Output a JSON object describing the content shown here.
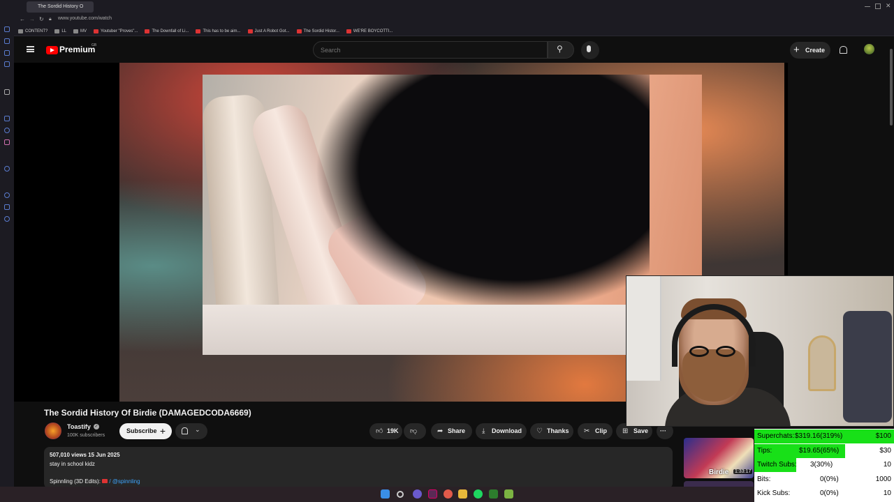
{
  "browser": {
    "tab_title": "The Sordid History O",
    "url": "www.youtube.com/watch",
    "bookmarks": [
      {
        "label": "CONTENT?"
      },
      {
        "label": "LL"
      },
      {
        "label": "MV"
      },
      {
        "label": "Youtuber \"Proves\"..."
      },
      {
        "label": "The Downfall of Li..."
      },
      {
        "label": "This has to be aim..."
      },
      {
        "label": "Just A Robot Got..."
      },
      {
        "label": "The Sordid Histor..."
      },
      {
        "label": "WE'RE BOYCOTTI..."
      }
    ]
  },
  "yt_header": {
    "logo_text": "Premium",
    "region": "GB",
    "search_placeholder": "Search",
    "create_label": "Create"
  },
  "video": {
    "title": "The Sordid History Of Birdie (DAMAGEDCODA6669)",
    "channel": "Toastify",
    "subscribers": "100K subscribers",
    "subscribe_label": "Subscribe",
    "likes": "19K",
    "share_label": "Share",
    "download_label": "Download",
    "thanks_label": "Thanks",
    "clip_label": "Clip",
    "save_label": "Save",
    "more_label": "···"
  },
  "description": {
    "views_date": "507,010 views  15 Jun 2025",
    "text": "stay in school kidz",
    "credit_prefix": "Spinnling (3D Edits): ",
    "credit_link": "/ @spinnling"
  },
  "related": {
    "thumb_text": "Birdie",
    "duration": "1:33:17"
  },
  "stats": [
    {
      "label": "Superchats:",
      "value": "$319.16(319%)",
      "goal": "$100",
      "fill": 1.0
    },
    {
      "label": "Tips:",
      "value": "$19.65(65%)",
      "goal": "$30",
      "fill": 0.65
    },
    {
      "label": "Twitch Subs:",
      "value": "3(30%)",
      "goal": "10",
      "fill": 0.3
    },
    {
      "label": "Bits:",
      "value": "0(0%)",
      "goal": "1000",
      "fill": 0
    },
    {
      "label": "Kick Subs:",
      "value": "0(0%)",
      "goal": "10",
      "fill": 0
    }
  ],
  "colors": {
    "youtube_red": "#ff0000",
    "progress_green": "#18e018",
    "link_blue": "#3ea6ff"
  }
}
